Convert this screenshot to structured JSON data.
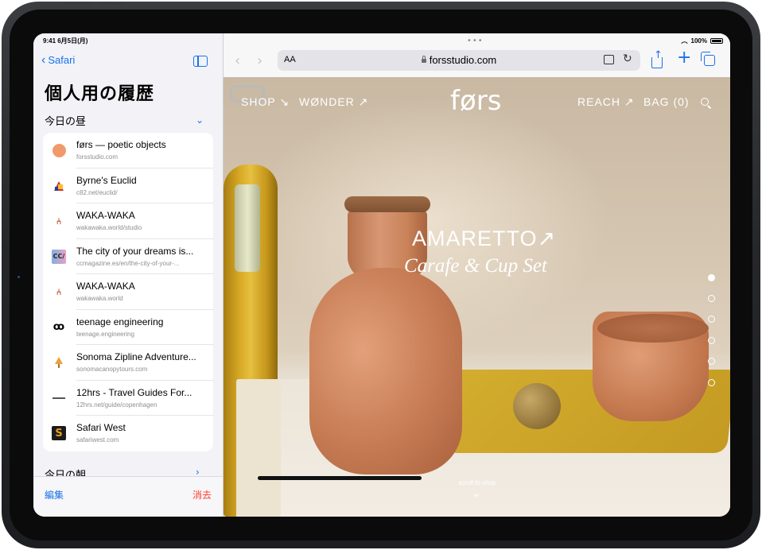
{
  "status": {
    "time_date": "9:41 6月5日(月)",
    "battery": "100%"
  },
  "sidebar": {
    "back_label": "Safari",
    "title": "個人用の履歴",
    "section_today_afternoon": "今日の昼",
    "section_today_morning": "今日の朝",
    "items": [
      {
        "title": "førs — poetic objects",
        "url": "forsstudio.com",
        "icon": "circle-orange",
        "icon_color": "#f09a6b"
      },
      {
        "title": "Byrne's Euclid",
        "url": "c82.net/euclid/",
        "icon": "euclid-shapes-icon"
      },
      {
        "title": "WAKA-WAKA",
        "url": "wakawaka.world/studio",
        "icon": "chair-icon"
      },
      {
        "title": "The city of your dreams is...",
        "url": "ccmagazine.es/en/the-city-of-your-...",
        "icon_text": "CC/"
      },
      {
        "title": "WAKA-WAKA",
        "url": "wakawaka.world",
        "icon": "chair-icon"
      },
      {
        "title": "teenage engineering",
        "url": "teenage.engineering",
        "icon_text": "ꝏ"
      },
      {
        "title": "Sonoma Zipline Adventure...",
        "url": "sonomacanopytours.com",
        "icon": "tree-icon"
      },
      {
        "title": "12hrs - Travel Guides For...",
        "url": "12hrs.net/guide/copenhagen",
        "icon": "dash-icon"
      },
      {
        "title": "Safari West",
        "url": "safariwest.com",
        "icon_text": "S"
      }
    ],
    "edit_label": "編集",
    "clear_label": "消去"
  },
  "browser": {
    "aa_label": "AA",
    "url": "forsstudio.com"
  },
  "site": {
    "nav_shop": "SHOP ↘",
    "nav_wonder": "WØNDER ↗",
    "logo": "førs",
    "nav_reach": "REACH ↗",
    "nav_bag": "BAG (0)",
    "hero_title": "AMARETTO↗",
    "hero_subtitle": "Carafe & Cup Set",
    "scroll_hint": "scroll to shop",
    "pager_count": 6,
    "pager_active": 1
  },
  "colors": {
    "accent": "#1a73e8",
    "destructive": "#ff3b30"
  }
}
